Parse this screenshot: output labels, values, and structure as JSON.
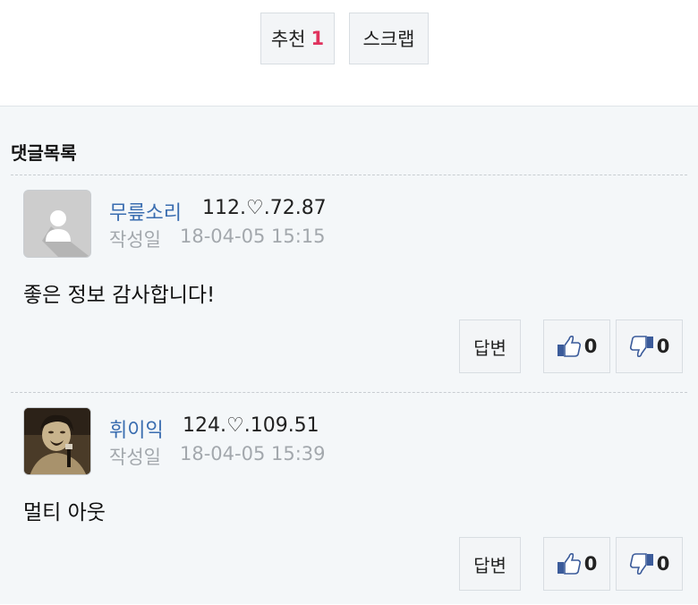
{
  "top_actions": {
    "recommend_label": "추천",
    "recommend_count": "1",
    "scrap_label": "스크랩"
  },
  "comments_panel": {
    "title": "댓글목록"
  },
  "comments": [
    {
      "nickname": "무릎소리",
      "ip": "112.♡.72.87",
      "date_label": "작성일",
      "date": "18-04-05 15:15",
      "text": "좋은 정보 감사합니다!",
      "reply_label": "답변",
      "likes": "0",
      "dislikes": "0",
      "avatar_icon": "default-user-icon"
    },
    {
      "nickname": "휘이익",
      "ip": "124.♡.109.51",
      "date_label": "작성일",
      "date": "18-04-05 15:39",
      "text": "멀티 아웃",
      "reply_label": "답변",
      "likes": "0",
      "dislikes": "0",
      "avatar_icon": "profile-photo"
    }
  ],
  "colors": {
    "accent_count": "#e0325d",
    "nickname": "#3a6db0",
    "muted": "#a3a8ad",
    "panel_bg": "#f4f7f9"
  }
}
